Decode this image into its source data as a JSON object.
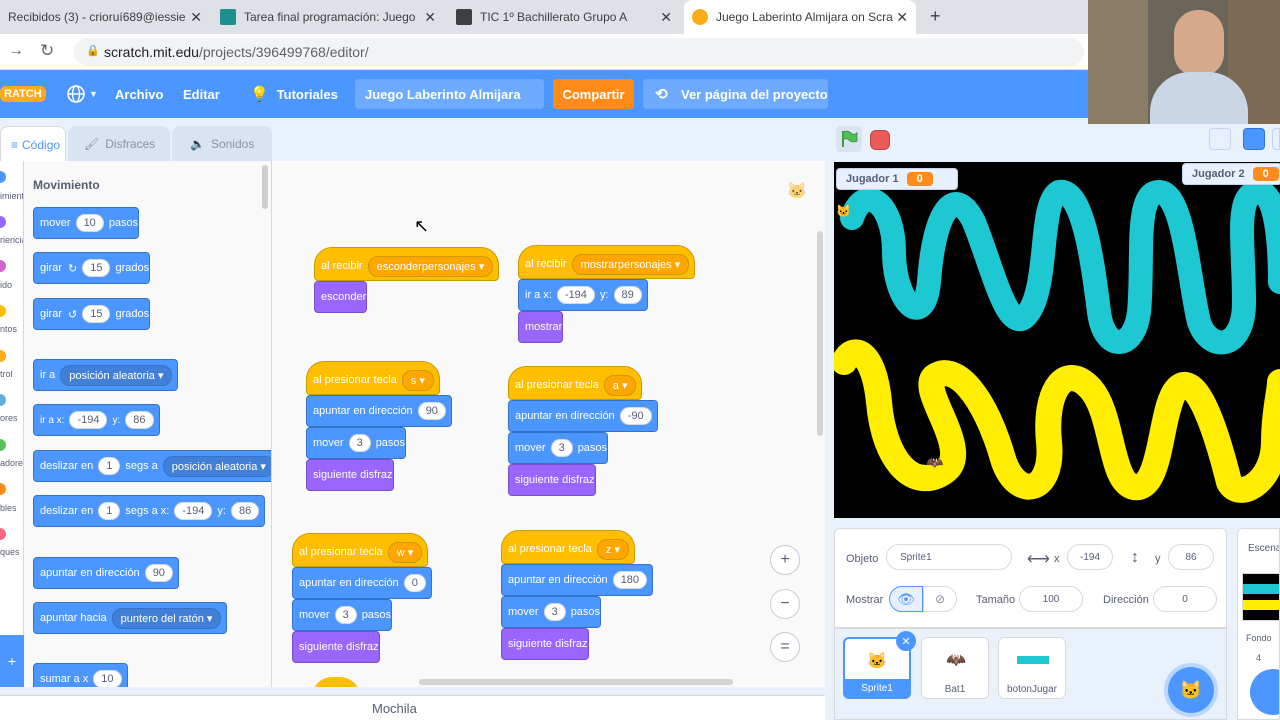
{
  "browser": {
    "tabs": [
      {
        "title": "Recibidos (3) - crioruí689@iessie",
        "color": "#ea4335"
      },
      {
        "title": "Tarea final programación: Juego",
        "color": "#1e8e8e"
      },
      {
        "title": "TIC 1º Bachillerato Grupo A",
        "color": "#3c4043"
      },
      {
        "title": "Juego Laberinto Almijara on Scra",
        "color": "#ffab19"
      }
    ],
    "url_host": "scratch.mit.edu",
    "url_path": "/projects/396499768/editor/"
  },
  "menubar": {
    "logo": "RATCH",
    "archivo": "Archivo",
    "editar": "Editar",
    "tutoriales": "Tutoriales",
    "project_title": "Juego Laberinto Almijara",
    "share": "Compartir",
    "project_page": "Ver página del proyecto"
  },
  "editor_tabs": {
    "code": "Código",
    "costumes": "Disfraces",
    "sounds": "Sonidos"
  },
  "categories": [
    {
      "label": "imiento",
      "color": "#4c97ff"
    },
    {
      "label": "riencia",
      "color": "#9966ff"
    },
    {
      "label": "ido",
      "color": "#cf63cf"
    },
    {
      "label": "ntos",
      "color": "#ffbf00"
    },
    {
      "label": "trol",
      "color": "#ffab19"
    },
    {
      "label": "ores",
      "color": "#5cb1d6"
    },
    {
      "label": "adores",
      "color": "#59c059"
    },
    {
      "label": "bles",
      "color": "#ff8c1a"
    },
    {
      "label": "ques",
      "color": "#ff6680"
    }
  ],
  "palette": {
    "heading": "Movimiento",
    "move": {
      "a": "mover",
      "v": "10",
      "b": "pasos"
    },
    "turn_right": {
      "a": "girar",
      "v": "15",
      "b": "grados"
    },
    "turn_left": {
      "a": "girar",
      "v": "15",
      "b": "grados"
    },
    "goto": {
      "a": "ir a",
      "dd": "posición aleatoria"
    },
    "gotoxy": {
      "a": "ir a x:",
      "x": "-194",
      "b": "y:",
      "y": "86"
    },
    "glide_to": {
      "a": "deslizar en",
      "v": "1",
      "b": "segs a",
      "dd": "posición aleatoria"
    },
    "glide_xy": {
      "a": "deslizar en",
      "v": "1",
      "b": "segs a x:",
      "x": "-194",
      "c": "y:",
      "y": "86"
    },
    "point_dir": {
      "a": "apuntar en dirección",
      "v": "90"
    },
    "point_towards": {
      "a": "apuntar hacia",
      "dd": "puntero del ratón"
    },
    "change_x": {
      "a": "sumar a x",
      "v": "10"
    }
  },
  "scripts": {
    "s1": {
      "hat": "al recibir",
      "msg": "esconderpersonajes",
      "b1": "esconder"
    },
    "s2": {
      "hat": "al recibir",
      "msg": "mostrarpersonajes",
      "ira": "ir a x:",
      "x": "-194",
      "y_lbl": "y:",
      "y": "89",
      "b2": "mostrar"
    },
    "s3": {
      "hat": "al presionar tecla",
      "key": "s",
      "point": "apuntar en dirección",
      "dir": "90",
      "move": "mover",
      "steps": "3",
      "pasos": "pasos",
      "next": "siguiente disfraz"
    },
    "s4": {
      "hat": "al presionar tecla",
      "key": "a",
      "point": "apuntar en dirección",
      "dir": "-90",
      "move": "mover",
      "steps": "3",
      "pasos": "pasos",
      "next": "siguiente disfraz"
    },
    "s5": {
      "hat": "al presionar tecla",
      "key": "w",
      "point": "apuntar en dirección",
      "dir": "0",
      "move": "mover",
      "steps": "3",
      "pasos": "pasos",
      "next": "siguiente disfraz"
    },
    "s6": {
      "hat": "al presionar tecla",
      "key": "z",
      "point": "apuntar en dirección",
      "dir": "180",
      "move": "mover",
      "steps": "3",
      "pasos": "pasos",
      "next": "siguiente disfraz"
    }
  },
  "zoom": {
    "in": "+",
    "out": "−",
    "reset": "="
  },
  "backpack": "Mochila",
  "stage": {
    "p1_label": "Jugador 1",
    "p1_score": "0",
    "p2_label": "Jugador 2",
    "p2_score": "0",
    "cyan": "#1ec8d2",
    "yellow": "#ffee00"
  },
  "sprite_info": {
    "object_lbl": "Objeto",
    "object_val": "Sprite1",
    "x_lbl": "x",
    "x_val": "-194",
    "y_lbl": "y",
    "y_val": "86",
    "show_lbl": "Mostrar",
    "size_lbl": "Tamaño",
    "size_val": "100",
    "dir_lbl": "Dirección",
    "dir_val": "0"
  },
  "sprites": [
    {
      "name": "Sprite1"
    },
    {
      "name": "Bat1"
    },
    {
      "name": "botonJugar"
    }
  ],
  "stage_panel": {
    "title": "Escena",
    "fondos": "Fondo",
    "count": "4"
  }
}
